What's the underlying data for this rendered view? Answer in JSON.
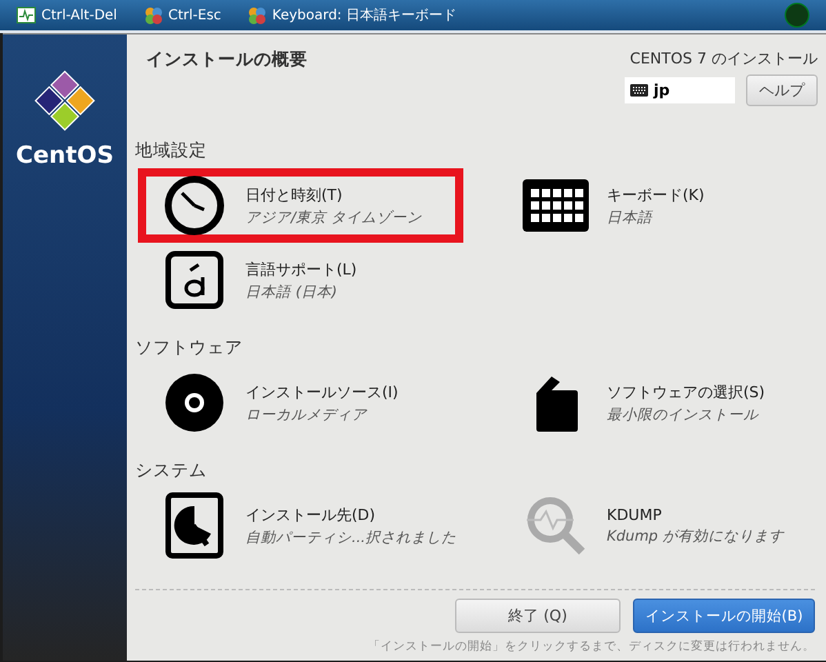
{
  "taskbar": {
    "items": [
      {
        "kind": "monitor",
        "label": "Ctrl-Alt-Del"
      },
      {
        "kind": "globe",
        "label": "Ctrl-Esc"
      },
      {
        "kind": "globe",
        "label": "Keyboard: 日本語キーボード"
      }
    ]
  },
  "sidebar": {
    "logo_text": "CentOS"
  },
  "header": {
    "title": "インストールの概要",
    "product": "CENTOS 7 のインストール",
    "keyboard_layout": "jp",
    "help_button": "ヘルプ"
  },
  "sections": [
    {
      "title": "地域設定",
      "spokes": [
        {
          "kind": "clock",
          "title": "日付と時刻(T)",
          "status": "アジア/東京 タイムゾーン",
          "highlighted": true
        },
        {
          "kind": "keyboard",
          "title": "キーボード(K)",
          "status": "日本語",
          "highlighted": false
        },
        {
          "kind": "language",
          "title": "言語サポート(L)",
          "status": "日本語 (日本)",
          "highlighted": false
        }
      ]
    },
    {
      "title": "ソフトウェア",
      "spokes": [
        {
          "kind": "disc",
          "title": "インストールソース(I)",
          "status": "ローカルメディア",
          "highlighted": false
        },
        {
          "kind": "package",
          "title": "ソフトウェアの選択(S)",
          "status": "最小限のインストール",
          "highlighted": false
        }
      ]
    },
    {
      "title": "システム",
      "spokes": [
        {
          "kind": "harddisk",
          "title": "インストール先(D)",
          "status": "自動パーティシ...択されました",
          "highlighted": false
        },
        {
          "kind": "search",
          "title": "KDUMP",
          "status": "Kdump が有効になります",
          "highlighted": false
        }
      ]
    }
  ],
  "buttons": [
    {
      "kind": "secondary",
      "label": "終了 (Q)"
    },
    {
      "kind": "primary",
      "label": "インストールの開始(B)"
    }
  ],
  "footer_note": "「インストールの開始」をクリックするまで、ディスクに変更は行われません。"
}
